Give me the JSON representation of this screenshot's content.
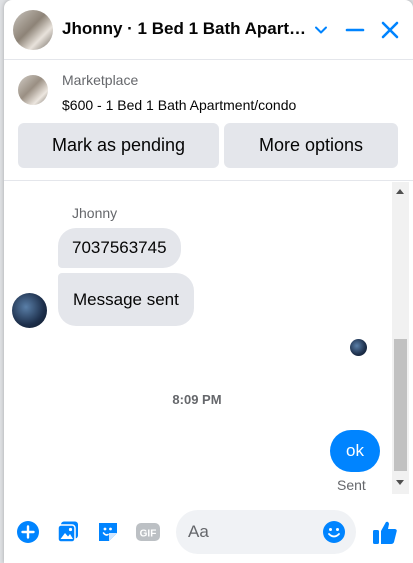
{
  "header": {
    "title": "Jhonny · 1 Bed 1 Bath Apartment/condo"
  },
  "marketplace": {
    "label": "Marketplace",
    "item": "$600 - 1 Bed 1 Bath Apartment/condo",
    "mark_pending_label": "Mark as pending",
    "more_options_label": "More options"
  },
  "messages": {
    "sender_name": "Jhonny",
    "incoming": [
      "7037563745",
      "Message sent"
    ],
    "timestamp": "8:09 PM",
    "outgoing": "ok",
    "status": "Sent"
  },
  "composer": {
    "placeholder": "Aa"
  },
  "colors": {
    "accent": "#0084ff",
    "bubble_in": "#e4e6eb",
    "muted_text": "#65676b"
  },
  "icons": [
    "chevron-down-icon",
    "minimize-icon",
    "close-icon",
    "plus-icon",
    "image-icon",
    "sticker-icon",
    "gif-icon",
    "emoji-icon",
    "like-icon"
  ]
}
